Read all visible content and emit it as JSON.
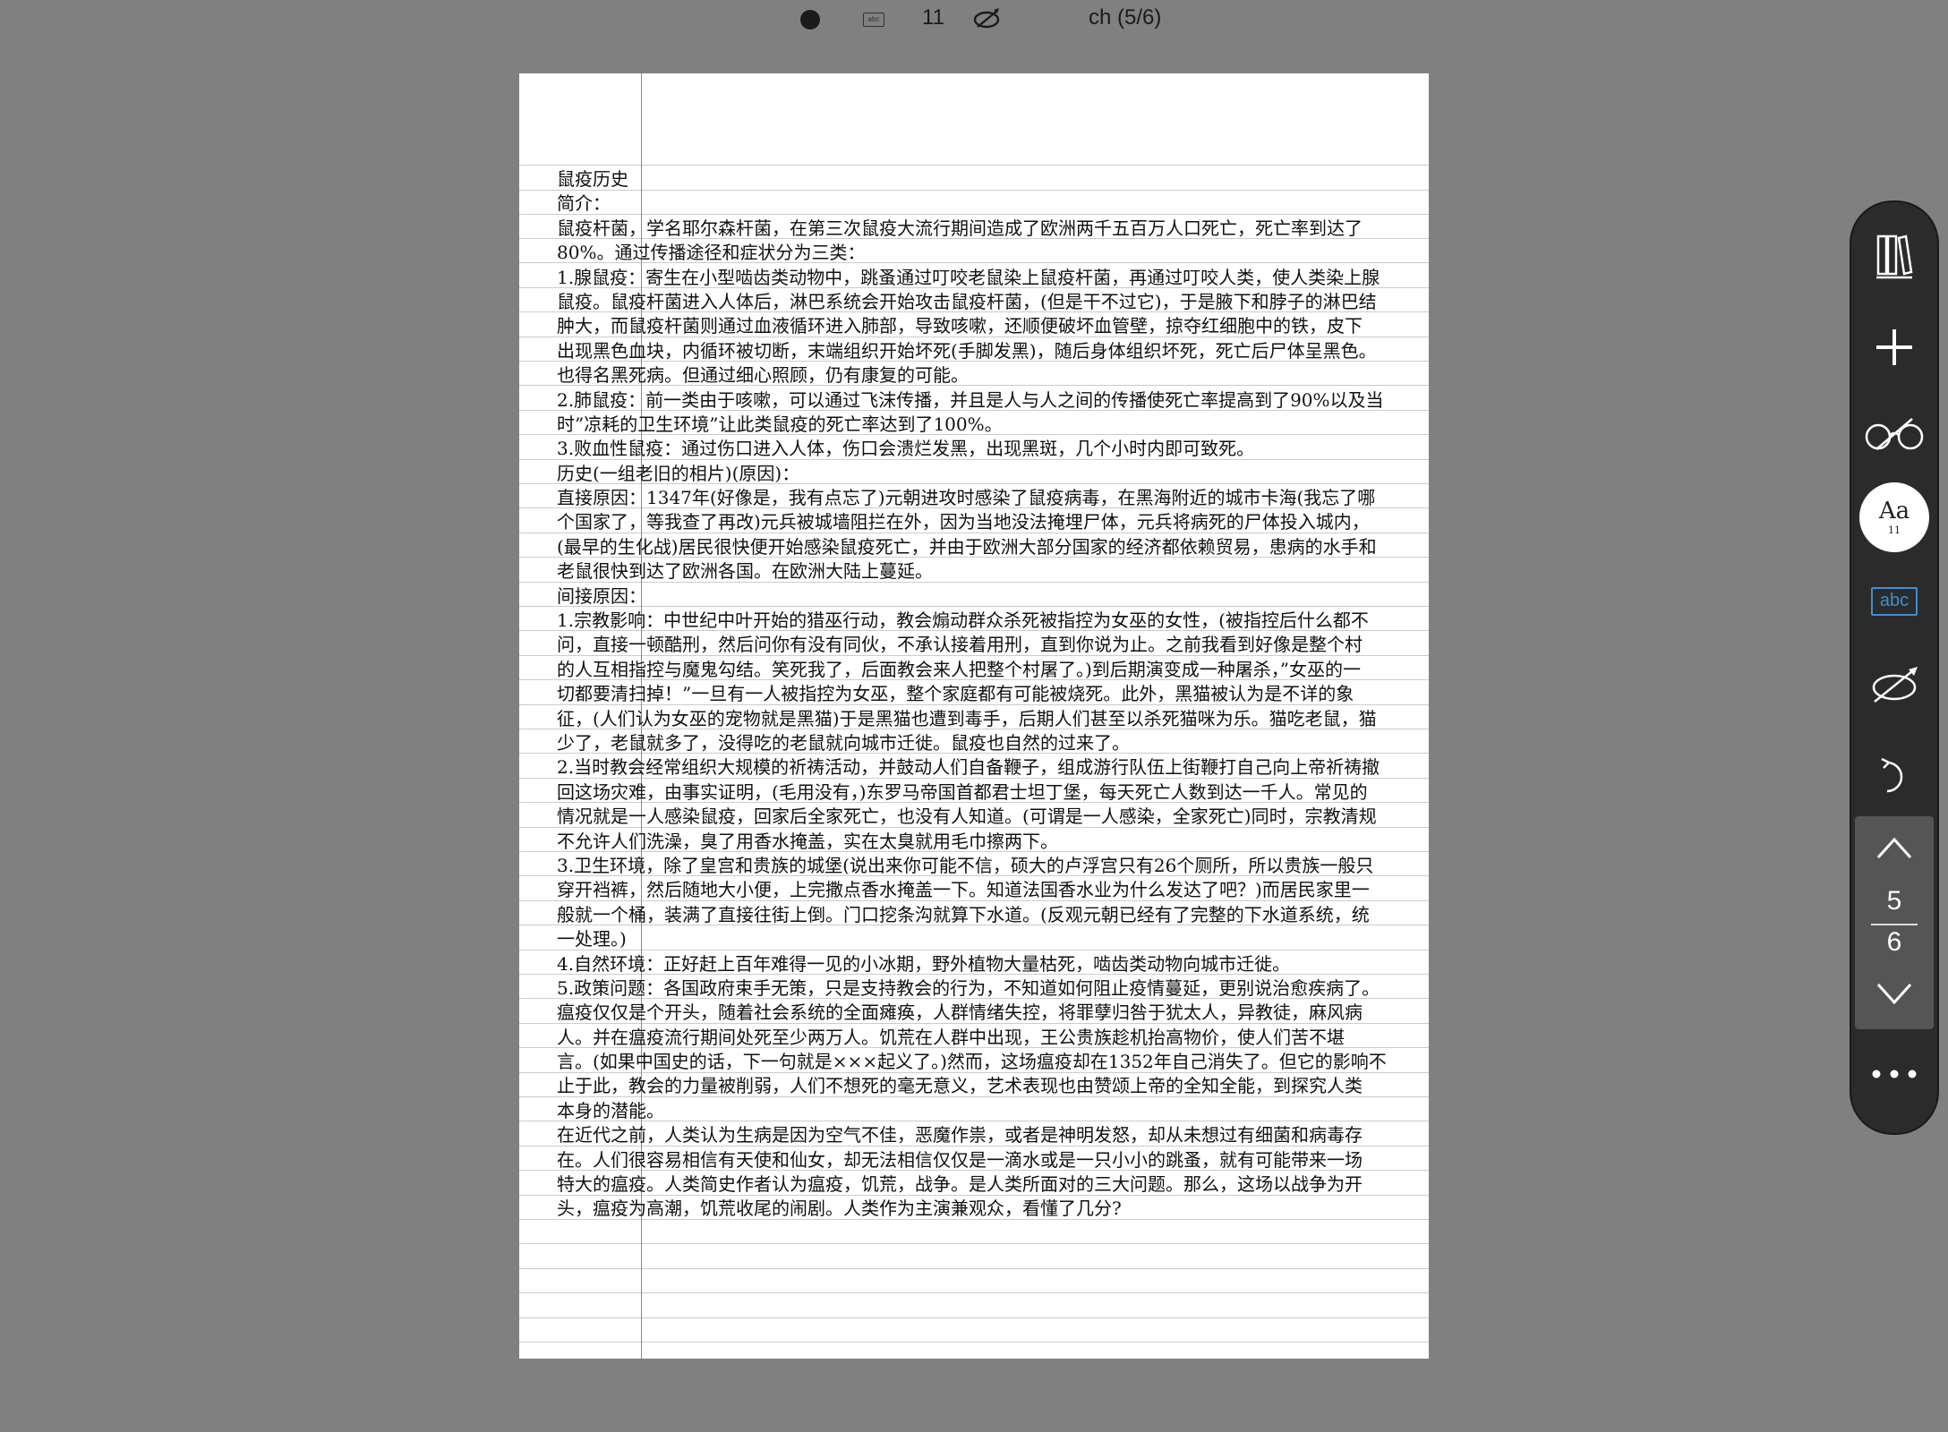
{
  "status_bar": {
    "font_size": "11",
    "chapter": "ch (5/6)",
    "abc_label": "abc"
  },
  "document": {
    "lines": [
      "鼠疫历史",
      "简介：",
      "鼠疫杆菌，学名耶尔森杆菌，在第三次鼠疫大流行期间造成了欧洲两千五百万人口死亡，死亡率到达了",
      "80%。通过传播途径和症状分为三类：",
      "1.腺鼠疫：寄生在小型啮齿类动物中，跳蚤通过叮咬老鼠染上鼠疫杆菌，再通过叮咬人类，使人类染上腺",
      "鼠疫。鼠疫杆菌进入人体后，淋巴系统会开始攻击鼠疫杆菌，(但是干不过它)，于是腋下和脖子的淋巴结",
      "肿大，而鼠疫杆菌则通过血液循环进入肺部，导致咳嗽，还顺便破坏血管壁，掠夺红细胞中的铁，皮下",
      "出现黑色血块，内循环被切断，末端组织开始坏死(手脚发黑)，随后身体组织坏死，死亡后尸体呈黑色。",
      "也得名黑死病。但通过细心照顾，仍有康复的可能。",
      "2.肺鼠疫：前一类由于咳嗽，可以通过飞沫传播，并且是人与人之间的传播使死亡率提高到了90%以及当",
      "时”凉耗的卫生环境”让此类鼠疫的死亡率达到了100%。",
      "3.败血性鼠疫：通过伤口进入人体，伤口会溃烂发黑，出现黑斑，几个小时内即可致死。",
      "历史(一组老旧的相片)(原因)：",
      "直接原因：1347年(好像是，我有点忘了)元朝进攻时感染了鼠疫病毒，在黑海附近的城市卡海(我忘了哪",
      "个国家了，等我查了再改)元兵被城墙阻拦在外，因为当地没法掩埋尸体，元兵将病死的尸体投入城内，",
      "(最早的生化战)居民很快便开始感染鼠疫死亡，并由于欧洲大部分国家的经济都依赖贸易，患病的水手和",
      "老鼠很快到达了欧洲各国。在欧洲大陆上蔓延。",
      "间接原因：",
      "1.宗教影响：中世纪中叶开始的猎巫行动，教会煽动群众杀死被指控为女巫的女性，(被指控后什么都不",
      "问，直接一顿酷刑，然后问你有没有同伙，不承认接着用刑，直到你说为止。之前我看到好像是整个村",
      "的人互相指控与魔鬼勾结。笑死我了，后面教会来人把整个村屠了。)到后期演变成一种屠杀，”女巫的一",
      "切都要清扫掉！”一旦有一人被指控为女巫，整个家庭都有可能被烧死。此外，黑猫被认为是不详的象",
      "征，(人们认为女巫的宠物就是黑猫)于是黑猫也遭到毒手，后期人们甚至以杀死猫咪为乐。猫吃老鼠，猫",
      "少了，老鼠就多了，没得吃的老鼠就向城市迁徙。鼠疫也自然的过来了。",
      "2.当时教会经常组织大规模的祈祷活动，并鼓动人们自备鞭子，组成游行队伍上街鞭打自己向上帝祈祷撤",
      "回这场灾难，由事实证明，(毛用没有，)东罗马帝国首都君士坦丁堡，每天死亡人数到达一千人。常见的",
      "情况就是一人感染鼠疫，回家后全家死亡，也没有人知道。(可谓是一人感染，全家死亡)同时，宗教清规",
      "不允许人们洗澡，臭了用香水掩盖，实在太臭就用毛巾擦两下。",
      "3.卫生环境，除了皇宫和贵族的城堡(说出来你可能不信，硕大的卢浮宫只有26个厕所，所以贵族一般只",
      "穿开裆裤，然后随地大小便，上完撒点香水掩盖一下。知道法国香水业为什么发达了吧？)而居民家里一",
      "般就一个桶，装满了直接往街上倒。门口挖条沟就算下水道。(反观元朝已经有了完整的下水道系统，统",
      "一处理。)",
      "4.自然环境：正好赶上百年难得一见的小冰期，野外植物大量枯死，啮齿类动物向城市迁徙。",
      "5.政策问题：各国政府束手无策，只是支持教会的行为，不知道如何阻止疫情蔓延，更别说治愈疾病了。",
      "瘟疫仅仅是个开头，随着社会系统的全面瘫痪，人群情绪失控，将罪孽归咎于犹太人，异教徒，麻风病",
      "人。并在瘟疫流行期间处死至少两万人。饥荒在人群中出现，王公贵族趁机抬高物价，使人们苦不堪",
      "言。(如果中国史的话，下一句就是×××起义了。)然而，这场瘟疫却在1352年自己消失了。但它的影响不",
      "止于此，教会的力量被削弱，人们不想死的毫无意义，艺术表现也由赞颂上帝的全知全能，到探究人类",
      "本身的潜能。",
      "在近代之前，人类认为生病是因为空气不佳，恶魔作祟，或者是神明发怒，却从未想过有细菌和病毒存",
      "在。人们很容易相信有天使和仙女，却无法相信仅仅是一滴水或是一只小小的跳蚤，就有可能带来一场",
      "特大的瘟疫。人类简史作者认为瘟疫，饥荒，战争。是人类所面对的三大问题。那么，这场以战争为开",
      "头，瘟疫为高潮，饥荒收尾的闹剧。人类作为主演兼观众，看懂了几分?"
    ]
  },
  "toolbar": {
    "font_button_label": "Aa",
    "font_button_size": "11",
    "abc_label": "abc",
    "current_page": "5",
    "total_pages": "6"
  },
  "colors": {
    "background": "#808080",
    "page": "#ffffff",
    "rule": "#cccccc",
    "margin_line": "#e06666",
    "toolbar": "#2b2b2b",
    "accent_blue": "#3d8fd6"
  }
}
